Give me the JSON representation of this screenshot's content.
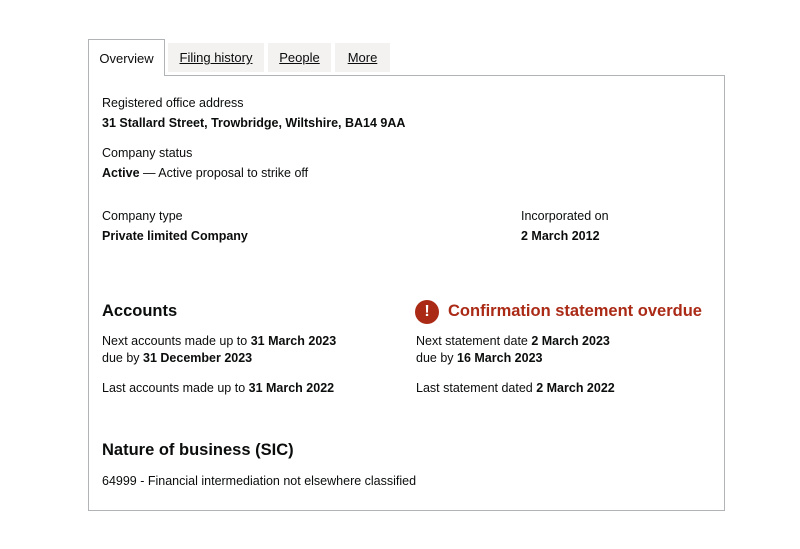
{
  "tabs": [
    {
      "label": "Overview"
    },
    {
      "label": "Filing history"
    },
    {
      "label": "People"
    },
    {
      "label": "More"
    }
  ],
  "registered_office": {
    "label": "Registered office address",
    "value": "31 Stallard Street, Trowbridge, Wiltshire, BA14 9AA"
  },
  "company_status": {
    "label": "Company status",
    "value": "Active",
    "detail": " — Active proposal to strike off"
  },
  "company_type": {
    "label": "Company type",
    "value": "Private limited Company"
  },
  "incorporated": {
    "label": "Incorporated on",
    "value": "2 March 2012"
  },
  "accounts": {
    "heading": "Accounts",
    "next_prefix": "Next accounts made up to ",
    "next_date": "31 March 2023",
    "due_prefix": "due by ",
    "due_date": "31 December 2023",
    "last_prefix": "Last accounts made up to ",
    "last_date": "31 March 2022"
  },
  "confirmation": {
    "icon": "!",
    "icon_name": "warning-icon",
    "heading": "Confirmation statement overdue",
    "color": "#aa2a16",
    "next_prefix": "Next statement date ",
    "next_date": "2 March 2023",
    "due_prefix": "due by ",
    "due_date": "16 March 2023",
    "last_prefix": "Last statement dated ",
    "last_date": "2 March 2022"
  },
  "nature_of_business": {
    "heading": "Nature of business (SIC)",
    "value": "64999 - Financial intermediation not elsewhere classified"
  }
}
